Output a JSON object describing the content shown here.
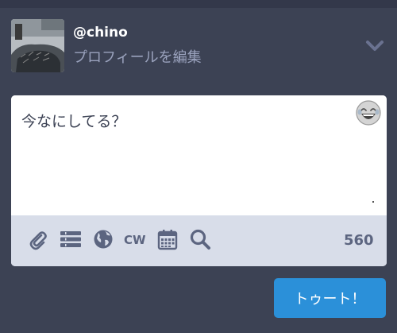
{
  "account": {
    "username": "@chino",
    "edit_profile_label": "プロフィールを編集"
  },
  "header": {
    "chevron_icon": "chevron-down-icon"
  },
  "compose": {
    "placeholder": "今なにしてる？",
    "emoji_icon": "laughing-emoji-icon",
    "char_count": "560",
    "tools": [
      "paperclip-icon",
      "list-icon",
      "globe-icon",
      "cw",
      "calendar-icon",
      "search-icon"
    ],
    "cw_label": "CW"
  },
  "actions": {
    "toot_label": "トゥート！"
  },
  "colors": {
    "background": "#3c4254",
    "toolbar": "#d8dde9",
    "icon": "#5c6580",
    "accent": "#2b90d9"
  }
}
